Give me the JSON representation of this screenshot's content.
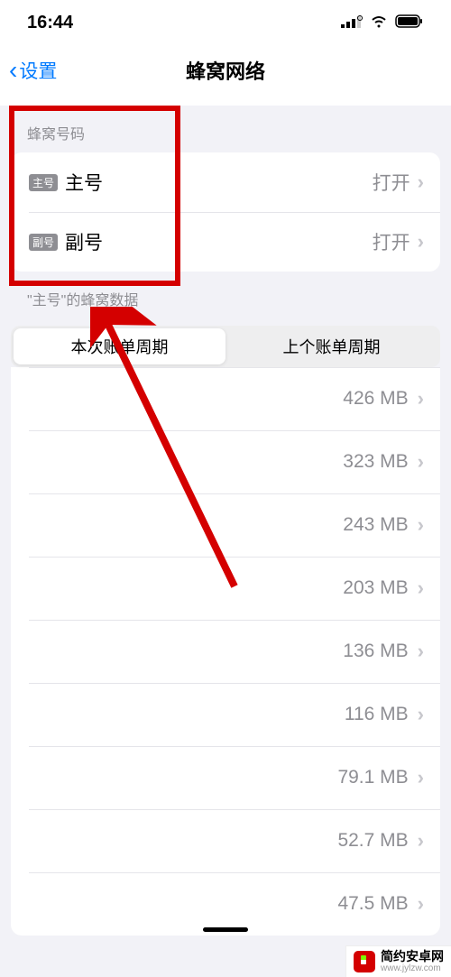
{
  "status": {
    "time": "16:44"
  },
  "nav": {
    "back": "设置",
    "title": "蜂窝网络"
  },
  "sim_section": {
    "header": "蜂窝号码",
    "items": [
      {
        "badge": "主号",
        "label": "主号",
        "value": "打开"
      },
      {
        "badge": "副号",
        "label": "副号",
        "value": "打开"
      }
    ]
  },
  "data_section": {
    "header": "\"主号\"的蜂窝数据",
    "tabs": [
      "本次账单周期",
      "上个账单周期"
    ],
    "usage": [
      "426 MB",
      "323 MB",
      "243 MB",
      "203 MB",
      "136 MB",
      "116 MB",
      "79.1 MB",
      "52.7 MB",
      "47.5 MB"
    ]
  },
  "watermark": {
    "title": "简约安卓网",
    "url": "www.jylzw.com"
  },
  "colors": {
    "accent": "#007aff",
    "highlight": "#d40000"
  }
}
